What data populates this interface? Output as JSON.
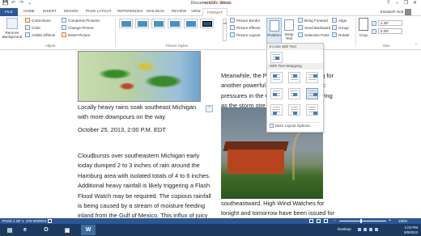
{
  "window": {
    "title": "Document22 - Word",
    "context_tab_group": "PICTURE TOOLS",
    "controls": [
      "?",
      "–",
      "❐",
      "✕"
    ]
  },
  "qat": [
    "💾",
    "↶",
    "↷",
    "⌄"
  ],
  "tabs": {
    "file": "FILE",
    "items": [
      "HOME",
      "INSERT",
      "DESIGN",
      "PAGE LAYOUT",
      "REFERENCES",
      "MAILINGS",
      "REVIEW",
      "VIEW"
    ],
    "format": "FORMAT"
  },
  "user": {
    "name": "Elizabeth Nolt"
  },
  "ribbon": {
    "remove_background": "Remove Background",
    "adjust": {
      "corrections": "Corrections",
      "color": "Color",
      "artistic_effects": "Artistic Effects",
      "compress": "Compress Pictures",
      "change": "Change Picture",
      "reset": "Reset Picture",
      "label": "Adjust"
    },
    "picture_styles": {
      "label": "Picture Styles",
      "border": "Picture Border",
      "effects": "Picture Effects",
      "layout": "Picture Layout"
    },
    "arrange": {
      "position": "Position",
      "wrap_text": "Wrap Text",
      "bring_forward": "Bring Forward",
      "send_backward": "Send Backward",
      "selection_pane": "Selection Pane",
      "align": "Align",
      "group": "Group",
      "rotate": "Rotate"
    },
    "size": {
      "crop": "Crop",
      "label": "Size",
      "height": "2.26\"",
      "width": "5.09\""
    }
  },
  "wrap_menu": {
    "inline_heading": "In Line with Text",
    "wrapping_heading": "With Text Wrapping",
    "more_options": "More Layout Options..."
  },
  "document": {
    "caption": "Locally heavy rains soak southeast Michigan with more downpours on the way",
    "dateline": "October 25, 2013, 2:00 P.M. EDT",
    "body_left": "Cloudbursts over southeastern Michigan early today dumped 2 to 3 inches of rain around the Hamburg area with isolated totals of 4 to 6 inches. Additional heavy rainfall is likely triggering a Flash Flood Watch may be required. The copious rainfall is being caused by a stream of moisture feeding inland from the Gulf of Mexico. This influx of juicy air likely will",
    "body_right_top_1": "Meanwhile, the P",
    "body_right_top_1b": "cing for",
    "body_right_top_2": "another powerful",
    "body_right_top_2b": "heric",
    "body_right_top_3": "pressures in the G",
    "body_right_top_3b": "diving",
    "body_right_top_4": "as the storm stre",
    "body_right_bottom": "southeastward. High Wind Watches for tonight and tomorrow have been issued for the"
  },
  "status": {
    "page": "PAGE 1 OF 1",
    "words": "276 WORDS",
    "zoom_minus": "–",
    "zoom_plus": "+",
    "zoom_level": "100%"
  },
  "taskbar": {
    "desktop": "Desktop",
    "time": "1:04 PM",
    "date": "3/9/2013"
  },
  "colors": {
    "word_blue": "#2b579a",
    "format_tab": "#a0522d",
    "taskbar": "#1d3b5e"
  }
}
